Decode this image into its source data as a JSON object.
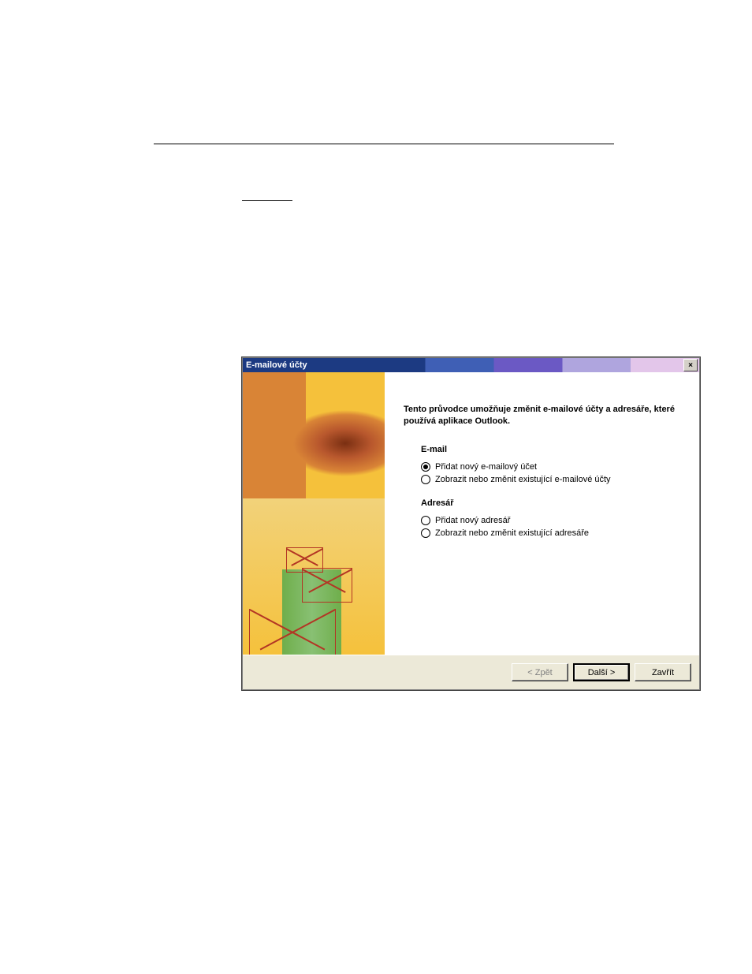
{
  "dialog": {
    "title": "E-mailové účty",
    "intro": "Tento průvodce umožňuje změnit e-mailové účty a adresáře, které používá aplikace Outlook.",
    "sections": {
      "email": {
        "heading": "E-mail",
        "opt_add": "Přidat nový e-mailový účet",
        "opt_edit": "Zobrazit nebo změnit existující e-mailové účty"
      },
      "address": {
        "heading": "Adresář",
        "opt_add": "Přidat nový adresář",
        "opt_edit": "Zobrazit nebo změnit existující adresáře"
      }
    },
    "buttons": {
      "back": "< Zpět",
      "next": "Další >",
      "close": "Zavřít"
    },
    "close_icon": "×"
  }
}
